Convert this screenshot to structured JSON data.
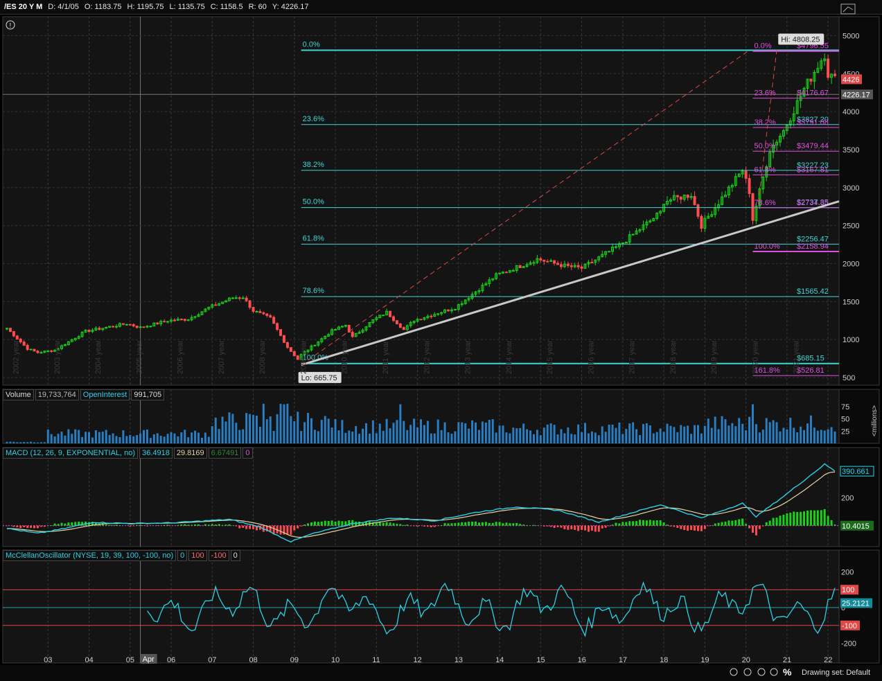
{
  "header": {
    "symbol": "/ES 20 Y M",
    "date": "D: 4/1/05",
    "open": "O: 1183.75",
    "high": "H: 1195.75",
    "low": "L: 1135.75",
    "close": "C: 1158.5",
    "range": "R: 60",
    "y": "Y: 4226.17"
  },
  "price_labels": {
    "high": "Hi: 4808.25",
    "low": "Lo: 665.75",
    "last": "4426",
    "cursor": "4226.17"
  },
  "volume_panel": {
    "label": "Volume",
    "volume": "19,733,764",
    "oi_label": "OpenInterest",
    "oi": "991,705",
    "unit": "<millions>",
    "ticks": [
      "75",
      "50",
      "25"
    ]
  },
  "macd_panel": {
    "label": "MACD (12, 26, 9, EXPONENTIAL, no)",
    "value": "36.4918",
    "avg": "29.8169",
    "diff": "6.67491",
    "zero": "0",
    "last_value": "390.661",
    "last_diff": "10.4015",
    "tick": "200"
  },
  "mcclellan_panel": {
    "label": "McClellanOscillator (NYSE, 19, 39, 100, -100, no)",
    "z": "0",
    "ob": "100",
    "os": "-100",
    "z2": "0",
    "last_value": "25.2121",
    "ob_badge": "100",
    "os_badge": "-100",
    "ticks": [
      "200",
      "0",
      "-200"
    ]
  },
  "bottom_bar": {
    "drawing_set": "Drawing set: Default",
    "percent": "%"
  },
  "colors": {
    "up": "#19d319",
    "down": "#ff4d4d",
    "fib_cyan": "#3fd6d6",
    "fib_magenta": "#e050e0",
    "trend": "#c8c8c8",
    "macd": "#2bd2e6",
    "signal": "#e8d3a0"
  },
  "chart_data": [
    {
      "type": "candlestick",
      "title": "/ES 20 Y M",
      "ylim": [
        400,
        5250
      ],
      "y_ticks": [
        500,
        1000,
        1500,
        2000,
        2500,
        3000,
        3500,
        4000,
        4500,
        5000
      ],
      "year_labels": [
        "2002 year",
        "2003 year",
        "2004 year",
        "2005 year",
        "2006 year",
        "2007 year",
        "2008 year",
        "2009 year",
        "2010 year",
        "2011 year",
        "2012 year",
        "2013 year",
        "2014 year",
        "2015 year",
        "2016 year",
        "2017 year",
        "2018 year",
        "2019 year",
        "2020 year",
        "2021 year"
      ],
      "x_labels": [
        "03",
        "04",
        "05",
        "Apr",
        "06",
        "07",
        "08",
        "09",
        "10",
        "11",
        "12",
        "13",
        "14",
        "15",
        "16",
        "17",
        "18",
        "19",
        "20",
        "21",
        "22"
      ],
      "anchors": [
        {
          "date": "2002-01",
          "close": 1150
        },
        {
          "date": "2002-07",
          "close": 880
        },
        {
          "date": "2002-10",
          "close": 830
        },
        {
          "date": "2003-03",
          "close": 860
        },
        {
          "date": "2003-12",
          "close": 1110
        },
        {
          "date": "2004-12",
          "close": 1210
        },
        {
          "date": "2005-04",
          "close": 1158.5
        },
        {
          "date": "2005-12",
          "close": 1250
        },
        {
          "date": "2006-06",
          "close": 1270
        },
        {
          "date": "2006-12",
          "close": 1420
        },
        {
          "date": "2007-07",
          "close": 1550
        },
        {
          "date": "2007-10",
          "close": 1560
        },
        {
          "date": "2008-01",
          "close": 1380
        },
        {
          "date": "2008-06",
          "close": 1280
        },
        {
          "date": "2008-11",
          "close": 900
        },
        {
          "date": "2009-02",
          "close": 740
        },
        {
          "date": "2009-03",
          "close": 800
        },
        {
          "date": "2009-12",
          "close": 1115
        },
        {
          "date": "2010-04",
          "close": 1190
        },
        {
          "date": "2010-06",
          "close": 1030
        },
        {
          "date": "2010-12",
          "close": 1255
        },
        {
          "date": "2011-04",
          "close": 1360
        },
        {
          "date": "2011-09",
          "close": 1130
        },
        {
          "date": "2011-12",
          "close": 1255
        },
        {
          "date": "2012-12",
          "close": 1420
        },
        {
          "date": "2013-12",
          "close": 1845
        },
        {
          "date": "2014-12",
          "close": 2060
        },
        {
          "date": "2015-08",
          "close": 1970
        },
        {
          "date": "2016-01",
          "close": 1940
        },
        {
          "date": "2016-12",
          "close": 2240
        },
        {
          "date": "2017-12",
          "close": 2670
        },
        {
          "date": "2018-01",
          "close": 2820
        },
        {
          "date": "2018-09",
          "close": 2910
        },
        {
          "date": "2018-12",
          "close": 2500
        },
        {
          "date": "2019-12",
          "close": 3230
        },
        {
          "date": "2020-02",
          "close": 2950
        },
        {
          "date": "2020-03",
          "close": 2580
        },
        {
          "date": "2020-08",
          "close": 3500
        },
        {
          "date": "2020-12",
          "close": 3750
        },
        {
          "date": "2021-06",
          "close": 4300
        },
        {
          "date": "2021-12",
          "close": 4760
        },
        {
          "date": "2022-01",
          "close": 4500
        },
        {
          "date": "2022-03",
          "close": 4426
        }
      ],
      "high": 4808.25,
      "low": 665.75,
      "fib_large": [
        {
          "label": "0.0%",
          "value": 4808.25
        },
        {
          "label": "23.6%",
          "value": 3830
        },
        {
          "label": "38.2%",
          "value": 3227.23
        },
        {
          "label": "50.0%",
          "value": 2737.35
        },
        {
          "label": "61.8%",
          "value": 2256.47
        },
        {
          "label": "78.6%",
          "value": 1565.42
        },
        {
          "label": "100.0%",
          "value": 685.15
        }
      ],
      "fib_large_prices": [
        {
          "text": "$2737.35",
          "value": 2737.35
        },
        {
          "text": "$3227.23",
          "value": 3227.23
        },
        {
          "text": "$2256.47",
          "value": 2256.47
        },
        {
          "text": "$1565.42",
          "value": 1565.42
        },
        {
          "text": "$685.15",
          "value": 685.15
        }
      ],
      "fib_small": [
        {
          "label": "0.0%",
          "value": 4796.55,
          "price": "$4796.55"
        },
        {
          "label": "23.6%",
          "value": 4176.67,
          "price": "$4176.67"
        },
        {
          "label": "38.2%",
          "value": 3791.08,
          "price": "$3791.08"
        },
        {
          "label": "50.0%",
          "value": 3479.44,
          "price": "$3479.44"
        },
        {
          "label": "61.8%",
          "value": 3167.81,
          "price": "$3167.81"
        },
        {
          "label": "78.6%",
          "value": 2734.85,
          "price": "$2734.85"
        },
        {
          "label": "100.0%",
          "value": 2158.94,
          "price": "$2158.94"
        },
        {
          "label": "161.8%",
          "value": 526.81,
          "price": "$526.81"
        }
      ],
      "extra_price": {
        "text": "$3827.20",
        "value": 3827.2
      },
      "trendline": [
        {
          "date": "2009-03",
          "value": 665.75
        },
        {
          "date": "2022-03",
          "value": 2820
        }
      ],
      "dashed_line": [
        {
          "date": "2009-03",
          "value": 665.75
        },
        {
          "date": "2020-02",
          "value": 4808.25
        }
      ]
    },
    {
      "type": "bar",
      "title": "Volume",
      "ylim": [
        0,
        85
      ],
      "unit": "millions"
    },
    {
      "type": "line",
      "title": "MACD (12, 26, 9, EXPONENTIAL, no)",
      "series": [
        {
          "name": "Value",
          "anchors": [
            {
              "date": "2002-01",
              "v": -20
            },
            {
              "date": "2002-10",
              "v": -55
            },
            {
              "date": "2003-06",
              "v": -20
            },
            {
              "date": "2004-02",
              "v": 25
            },
            {
              "date": "2005-01",
              "v": 15
            },
            {
              "date": "2006-01",
              "v": 20
            },
            {
              "date": "2007-06",
              "v": 45
            },
            {
              "date": "2008-03",
              "v": -10
            },
            {
              "date": "2008-12",
              "v": -115
            },
            {
              "date": "2009-06",
              "v": -60
            },
            {
              "date": "2010-06",
              "v": 15
            },
            {
              "date": "2011-06",
              "v": 55
            },
            {
              "date": "2012-06",
              "v": 35
            },
            {
              "date": "2013-06",
              "v": 95
            },
            {
              "date": "2014-06",
              "v": 135
            },
            {
              "date": "2015-06",
              "v": 110
            },
            {
              "date": "2016-06",
              "v": 25
            },
            {
              "date": "2017-12",
              "v": 150
            },
            {
              "date": "2018-12",
              "v": 55
            },
            {
              "date": "2019-12",
              "v": 160
            },
            {
              "date": "2020-04",
              "v": 65
            },
            {
              "date": "2020-12",
              "v": 210
            },
            {
              "date": "2021-12",
              "v": 440
            },
            {
              "date": "2022-03",
              "v": 390.661
            }
          ]
        }
      ],
      "tick": 200
    },
    {
      "type": "line",
      "title": "McClellanOscillator (NYSE, 19, 39, 100, -100, no)",
      "ylim": [
        -250,
        250
      ],
      "ticks": [
        200,
        0,
        -200
      ]
    }
  ]
}
